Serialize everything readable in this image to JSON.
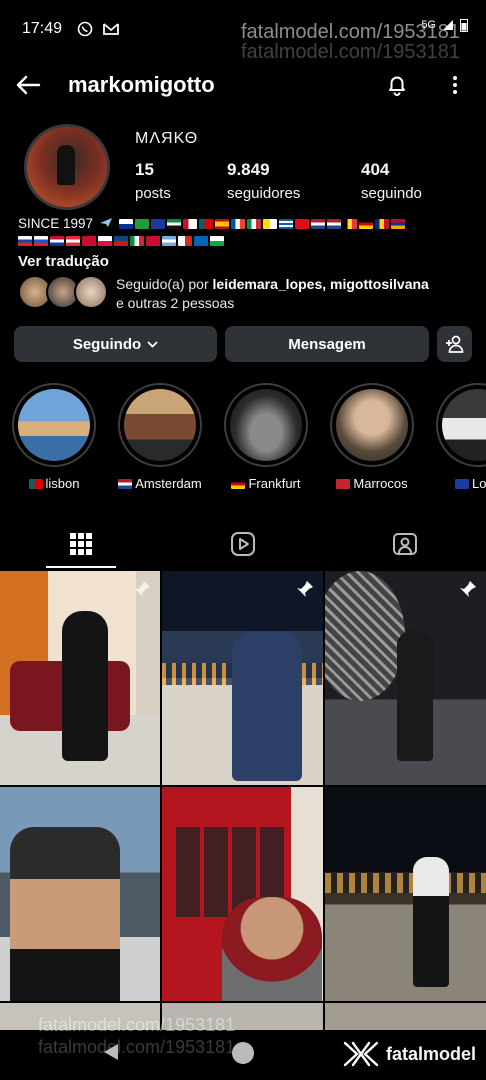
{
  "status": {
    "time": "17:49",
    "network": "5G"
  },
  "watermark": {
    "top": "fatalmodel.com/1953181",
    "bottom": "fatalmodel.com/1953181",
    "brand": "fatalmodel"
  },
  "header": {
    "username": "markomigotto",
    "icons": [
      "back-arrow-icon",
      "bell-icon",
      "more-vertical-icon"
    ]
  },
  "profile": {
    "display_name": "ΜΛЯΚΘ",
    "stats": {
      "posts_count": "15",
      "posts_label": "posts",
      "followers_count": "9.849",
      "followers_label": "seguidores",
      "following_count": "404",
      "following_label": "seguindo"
    },
    "bio": {
      "since": "SINCE 1997",
      "see_translation": "Ver tradução"
    },
    "followed_by": {
      "prefix": "Seguido(a) por",
      "names": "leidemara_lopes, migottosilvana",
      "suffix": "e outras 2 pessoas"
    }
  },
  "actions": {
    "following_label": "Seguindo",
    "message_label": "Mensagem"
  },
  "highlights": [
    {
      "label": "lisbon"
    },
    {
      "label": "Amsterdam"
    },
    {
      "label": "Frankfurt"
    },
    {
      "label": "Marrocos"
    },
    {
      "label": "Lond"
    }
  ],
  "tabs": [
    "grid-icon",
    "reels-icon",
    "tagged-icon"
  ],
  "colors": {
    "background": "#000000",
    "button": "#2f3338",
    "text": "#f5f5f5"
  }
}
